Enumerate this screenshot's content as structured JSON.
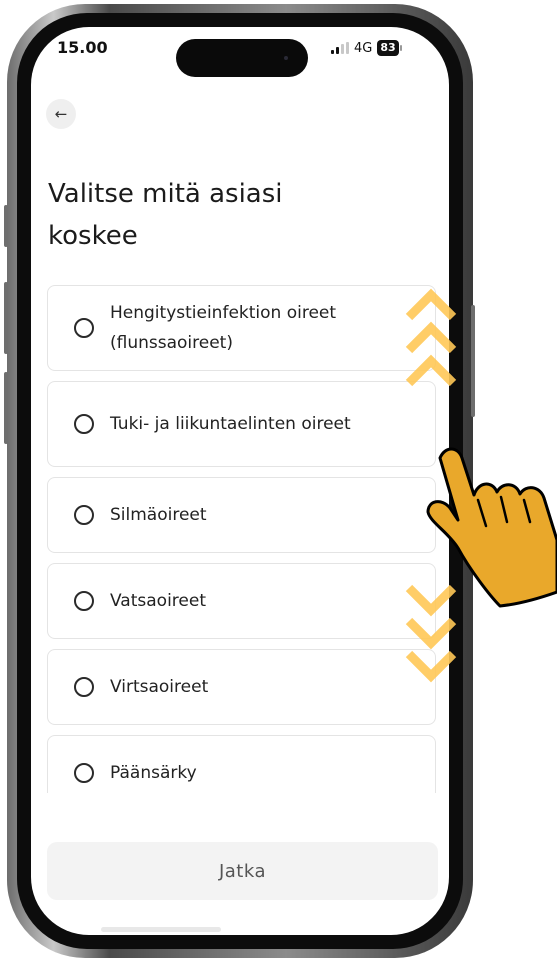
{
  "status_bar": {
    "time": "15.00",
    "network": "4G",
    "battery": "83"
  },
  "header": {
    "back_icon": "arrow-left-icon",
    "back_glyph": "←"
  },
  "page": {
    "title": "Valitse mitä asiasi koskee"
  },
  "options": [
    {
      "label": "Hengitystieinfektion oireet (flunssaoireet)"
    },
    {
      "label": "Tuki- ja liikuntaelinten oireet"
    },
    {
      "label": "Silmäoireet"
    },
    {
      "label": "Vatsaoireet"
    },
    {
      "label": "Virtsaoireet"
    },
    {
      "label": "Päänsärky"
    }
  ],
  "footer": {
    "continue_label": "Jatka"
  },
  "overlay": {
    "gesture_icon": "swipe-hand-icon",
    "scroll_up_icon": "chevrons-up-icon",
    "scroll_down_icon": "chevrons-down-icon",
    "accent_color": "#ffc857",
    "hand_color": "#e9a82b"
  }
}
